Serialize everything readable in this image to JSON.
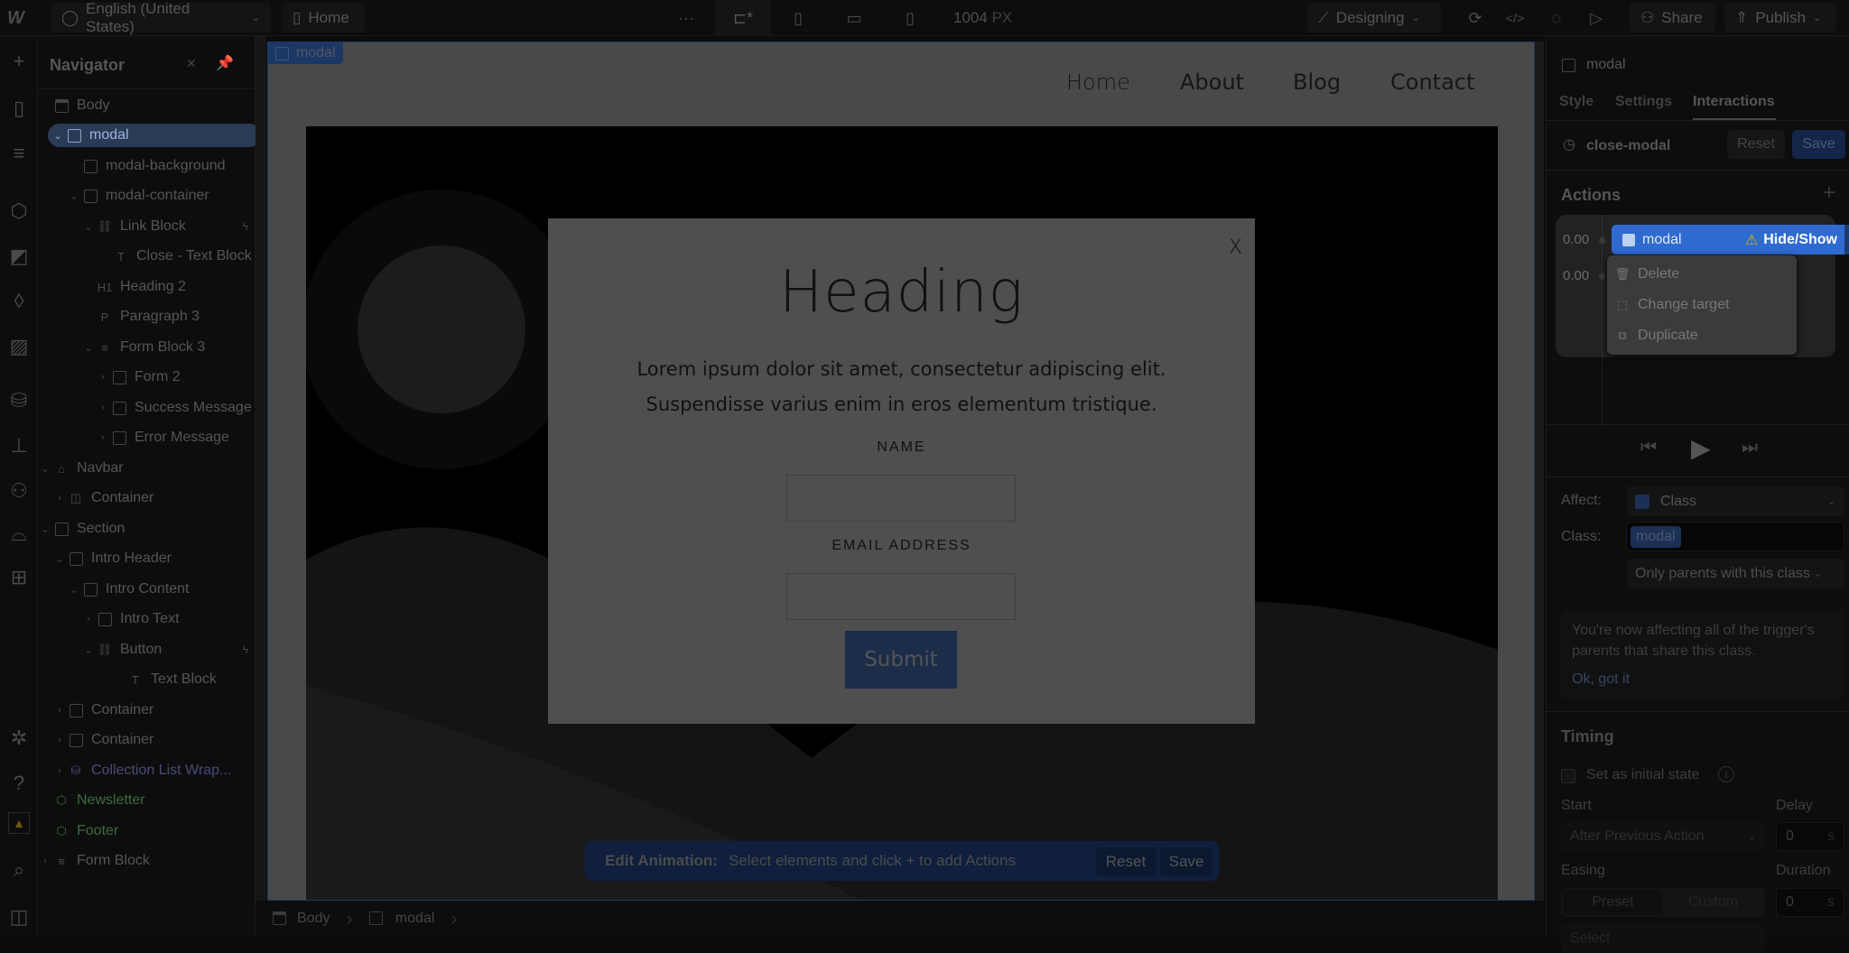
{
  "topbar": {
    "locale": "English (United States)",
    "page": "Home",
    "more": "···",
    "width_value": "1004",
    "width_unit": "PX",
    "mode": "Designing",
    "share": "Share",
    "publish": "Publish"
  },
  "navigator": {
    "title": "Navigator",
    "items": [
      {
        "label": "Body"
      },
      {
        "label": "modal"
      },
      {
        "label": "modal-background"
      },
      {
        "label": "modal-container"
      },
      {
        "label": "Link Block"
      },
      {
        "label": "Close - Text Block"
      },
      {
        "label": "Heading 2",
        "tag": "H1"
      },
      {
        "label": "Paragraph 3",
        "tag": "P"
      },
      {
        "label": "Form Block 3"
      },
      {
        "label": "Form 2"
      },
      {
        "label": "Success Message"
      },
      {
        "label": "Error Message"
      },
      {
        "label": "Navbar"
      },
      {
        "label": "Container"
      },
      {
        "label": "Section"
      },
      {
        "label": "Intro Header"
      },
      {
        "label": "Intro Content"
      },
      {
        "label": "Intro Text"
      },
      {
        "label": "Button"
      },
      {
        "label": "Text Block"
      },
      {
        "label": "Container"
      },
      {
        "label": "Container"
      },
      {
        "label": "Collection List Wrap..."
      },
      {
        "label": "Newsletter"
      },
      {
        "label": "Footer"
      },
      {
        "label": "Form Block"
      }
    ]
  },
  "canvas": {
    "selected_tag": "modal",
    "nav_links": [
      "Home",
      "About",
      "Blog",
      "Contact"
    ],
    "modal": {
      "close": "X",
      "heading": "Heading",
      "paragraph_line1": "Lorem ipsum dolor sit amet, consectetur adipiscing elit.",
      "paragraph_line2": "Suspendisse varius enim in eros elementum tristique.",
      "name_label": "NAME",
      "email_label": "EMAIL ADDRESS",
      "name_value": "",
      "email_value": "",
      "submit": "Submit"
    },
    "anim_bar": {
      "label": "Edit Animation:",
      "hint": "Select elements and click + to add Actions",
      "reset": "Reset",
      "save": "Save"
    }
  },
  "breadcrumb": [
    "Body",
    "modal"
  ],
  "right_panel": {
    "element": "modal",
    "tabs": [
      "Style",
      "Settings",
      "Interactions"
    ],
    "active_tab": "Interactions",
    "interaction_name": "close-modal",
    "reset": "Reset",
    "save": "Save",
    "actions_title": "Actions",
    "timeline": [
      {
        "time": "0.00",
        "target": "modal",
        "action": "Hide/Show"
      },
      {
        "time": "0.00"
      }
    ],
    "context_menu": [
      "Delete",
      "Change target",
      "Duplicate"
    ],
    "affect_label": "Affect:",
    "affect_value": "Class",
    "class_label": "Class:",
    "class_tag": "modal",
    "scope_value": "Only parents with this class",
    "notice": "You're now affecting all of the trigger's parents that share this class.",
    "notice_ok": "Ok, got it",
    "timing_title": "Timing",
    "initial_state_label": "Set as initial state",
    "initial_state_checked": false,
    "start_label": "Start",
    "start_value": "After Previous Action",
    "delay_label": "Delay",
    "delay_value": "0",
    "delay_unit": "S",
    "easing_label": "Easing",
    "easing_options": [
      "Preset",
      "Custom"
    ],
    "easing_selected": "Preset",
    "duration_label": "Duration",
    "duration_value": "0",
    "duration_unit": "S",
    "select_placeholder": "Select"
  },
  "colors": {
    "accent": "#2f6ad0",
    "selection_blue": "#1b3764",
    "overlay_dim": "#0c0c0c",
    "newsletter_green": "#3d6b3d",
    "collection_purple": "#4a4a7a",
    "warning_yellow": "#d9b000"
  }
}
